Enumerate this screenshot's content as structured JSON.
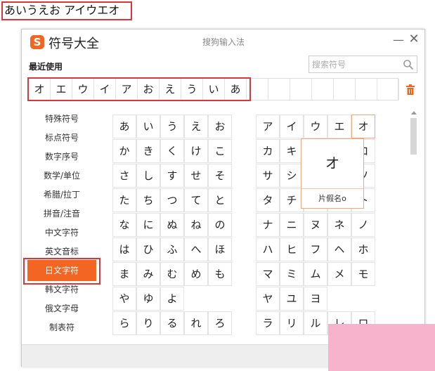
{
  "typed_text": "あいうえお アイウエオ",
  "window": {
    "logo": "S",
    "title": "符号大全",
    "center_title": "搜狗输入法",
    "minimize": "—",
    "close": "✕"
  },
  "recent": {
    "label": "最近使用",
    "chars": [
      "オ",
      "エ",
      "ウ",
      "イ",
      "ア",
      "お",
      "え",
      "う",
      "い",
      "あ",
      "",
      "",
      "",
      "",
      "",
      "",
      ""
    ]
  },
  "search": {
    "placeholder": "搜索符号",
    "value": ""
  },
  "sidebar": {
    "items": [
      "特殊符号",
      "标点符号",
      "数字序号",
      "数学/单位",
      "希腊/拉丁",
      "拼音/注音",
      "中文字符",
      "英文音标",
      "日文字符",
      "韩文字符",
      "俄文字母",
      "制表符"
    ],
    "active": "日文字符"
  },
  "hiragana_rows": [
    [
      "あ",
      "い",
      "う",
      "え",
      "お"
    ],
    [
      "か",
      "き",
      "く",
      "け",
      "こ"
    ],
    [
      "さ",
      "し",
      "す",
      "せ",
      "そ"
    ],
    [
      "た",
      "ち",
      "つ",
      "て",
      "と"
    ],
    [
      "な",
      "に",
      "ぬ",
      "ね",
      "の"
    ],
    [
      "は",
      "ひ",
      "ふ",
      "へ",
      "ほ"
    ],
    [
      "ま",
      "み",
      "む",
      "め",
      "も"
    ],
    [
      "や",
      "ゆ",
      "よ"
    ],
    [
      "ら",
      "り",
      "る",
      "れ",
      "ろ"
    ]
  ],
  "katakana_rows": [
    [
      "ア",
      "イ",
      "ウ",
      "エ",
      "オ"
    ],
    [
      "カ",
      "キ",
      "",
      "",
      "コ"
    ],
    [
      "サ",
      "シ",
      "",
      "",
      "ソ"
    ],
    [
      "タ",
      "チ",
      "",
      "",
      "ト"
    ],
    [
      "ナ",
      "ニ",
      "ヌ",
      "ネ",
      "ノ"
    ],
    [
      "ハ",
      "ヒ",
      "フ",
      "ヘ",
      "ホ"
    ],
    [
      "マ",
      "ミ",
      "ム",
      "メ",
      "モ"
    ],
    [
      "ヤ",
      "ユ",
      "ヨ"
    ],
    [
      "ラ",
      "リ",
      "ル",
      "レ",
      "ロ"
    ]
  ],
  "popup": {
    "char": "オ",
    "label": "片假名o"
  },
  "colors": {
    "accent": "#f26522",
    "highlight": "#d9363e",
    "overlay": "#f7b3cc"
  }
}
